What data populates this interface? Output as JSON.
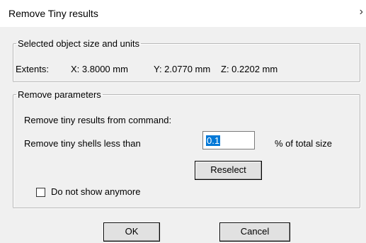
{
  "window": {
    "title": "Remove Tiny results",
    "close_glyph": "›"
  },
  "group_size": {
    "legend": "Selected object size and units",
    "extents_label": "Extents:",
    "x": "X: 3.8000 mm",
    "y": "Y: 2.0770 mm",
    "z": "Z: 0.2202 mm"
  },
  "group_params": {
    "legend": "Remove parameters",
    "from_command": "Remove tiny results from command:",
    "shells_label": "Remove tiny shells less than",
    "shells_value": "0.1",
    "percent_label": "% of total size",
    "reselect_label": "Reselect",
    "do_not_show_label": "Do not show anymore",
    "do_not_show_checked": false
  },
  "buttons": {
    "ok": "OK",
    "cancel": "Cancel"
  }
}
